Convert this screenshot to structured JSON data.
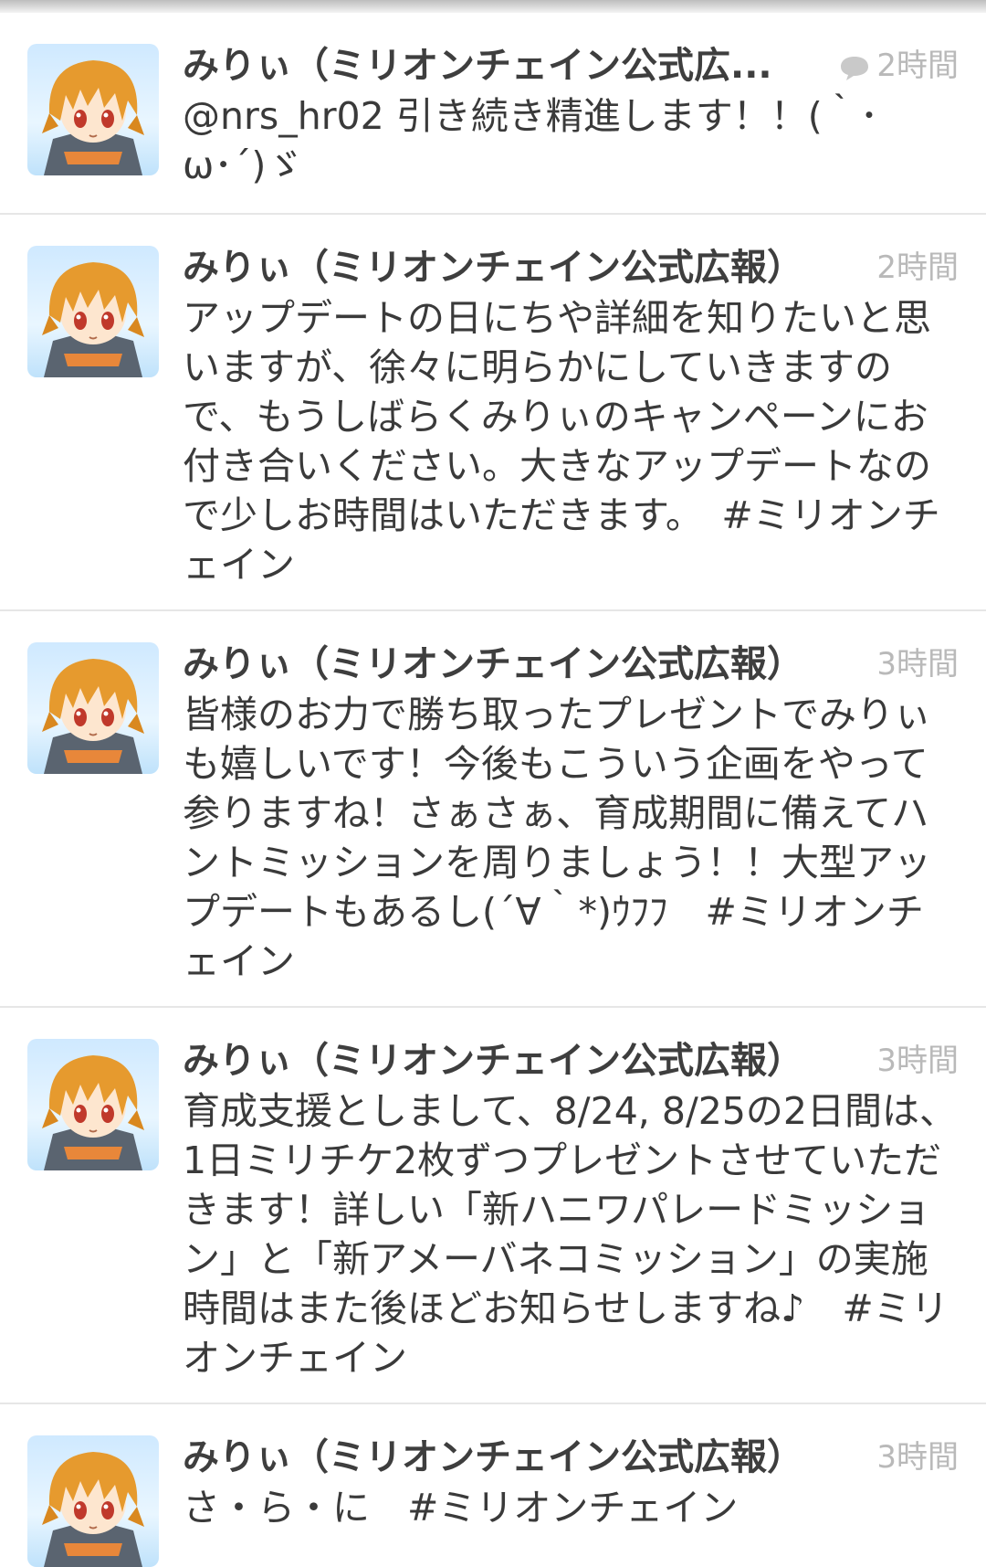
{
  "tweets": [
    {
      "name": "みりぃ（ミリオンチェイン公式広...",
      "time": "2時間",
      "text": "@nrs_hr02 引き続き精進します！！(｀･ω･´)ゞ"
    },
    {
      "name": "みりぃ（ミリオンチェイン公式広報）",
      "time": "2時間",
      "text": "アップデートの日にちや詳細を知りたいと思いますが、徐々に明らかにしていきますので、もうしばらくみりぃのキャンペーンにお付き合いください。大きなアップデートなので少しお時間はいただきます。　#ミリオンチェイン"
    },
    {
      "name": "みりぃ（ミリオンチェイン公式広報）",
      "time": "3時間",
      "text": "皆様のお力で勝ち取ったプレゼントでみりぃも嬉しいです！今後もこういう企画をやって参りますね！さぁさぁ、育成期間に備えてハントミッションを周りましょう！！大型アップデートもあるし(´∀｀*)ｳﾌﾌ　#ミリオンチェイン"
    },
    {
      "name": "みりぃ（ミリオンチェイン公式広報）",
      "time": "3時間",
      "text": "育成支援としまして、8/24, 8/25の2日間は、1日ミリチケ2枚ずつプレゼントさせていただきます！詳しい「新ハニワパレードミッション」と「新アメーバネコミッション」の実施時間はまた後ほどお知らせしますね♪　#ミリオンチェイン"
    },
    {
      "name": "みりぃ（ミリオンチェイン公式広報）",
      "time": "3時間",
      "text": "さ・ら・に　#ミリオンチェイン"
    }
  ],
  "icons": {
    "reply_indicator": "speech-bubble-icon"
  }
}
